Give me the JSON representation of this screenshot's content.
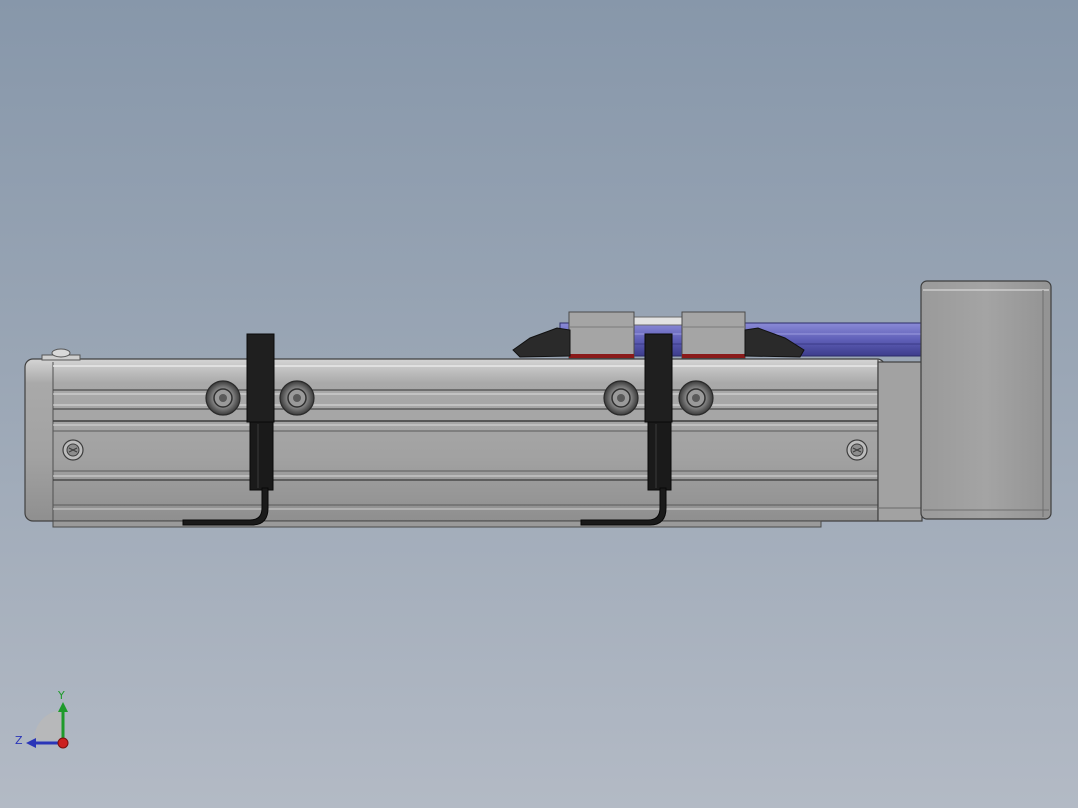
{
  "viewport": {
    "background_top": "#8797aa",
    "background_bottom": "#b3bac5"
  },
  "colors": {
    "profile_body": "#a4a4a4",
    "profile_dark": "#5a5a5a",
    "sensor_bracket": "#1c1c1c",
    "carriage_blue": "#6c6cc2",
    "seal_red": "#8a1a1a"
  },
  "triad": {
    "y_label": "Y",
    "z_label": "Z",
    "x_color": "#cc1f1f",
    "y_color": "#1e9a2b",
    "z_color": "#2a35b8"
  }
}
